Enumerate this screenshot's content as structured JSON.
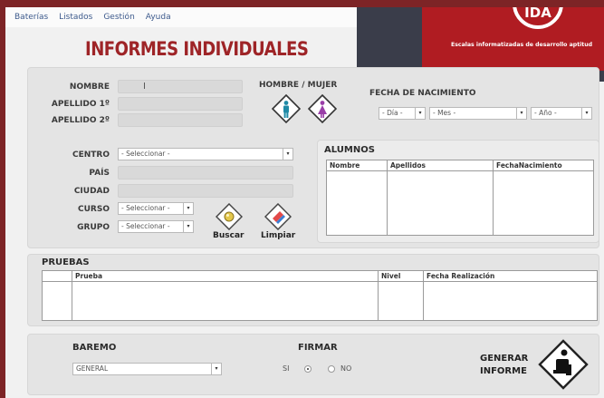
{
  "menu": [
    "Baterías",
    "Listados",
    "Gestión",
    "Ayuda"
  ],
  "page_title": "INFORMES INDIVIDUALES",
  "banner": {
    "logo_text": "IDA",
    "tagline": "Escalas informatizadas de desarrollo aptitud"
  },
  "form": {
    "nombre_label": "NOMBRE",
    "nombre_cursor": "I",
    "apellido1_label": "APELLIDO 1º",
    "apellido2_label": "APELLIDO 2º",
    "sexo_label": "HOMBRE / MUJER",
    "fecha_label": "FECHA DE NACIMIENTO",
    "dia": "- Día -",
    "mes": "- Mes -",
    "anio": "- Año -",
    "centro_label": "CENTRO",
    "centro_value": "- Seleccionar -",
    "pais_label": "PAÍS",
    "ciudad_label": "CIUDAD",
    "curso_label": "CURSO",
    "curso_value": "- Seleccionar -",
    "grupo_label": "GRUPO",
    "grupo_value": "- Seleccionar -",
    "buscar_label": "Buscar",
    "limpiar_label": "Limpiar"
  },
  "alumnos": {
    "title": "ALUMNOS",
    "columns": [
      "Nombre",
      "Apellidos",
      "FechaNacimiento"
    ]
  },
  "pruebas": {
    "title": "PRUEBAS",
    "columns": [
      "",
      "Prueba",
      "Nivel",
      "Fecha Realización"
    ]
  },
  "footer": {
    "baremo_label": "BAREMO",
    "baremo_value": "GENERAL",
    "firmar_label": "FIRMAR",
    "si": "SI",
    "no": "NO",
    "firmar_selected": "SI",
    "generar_line1": "GENERAR",
    "generar_line2": "INFORME"
  }
}
